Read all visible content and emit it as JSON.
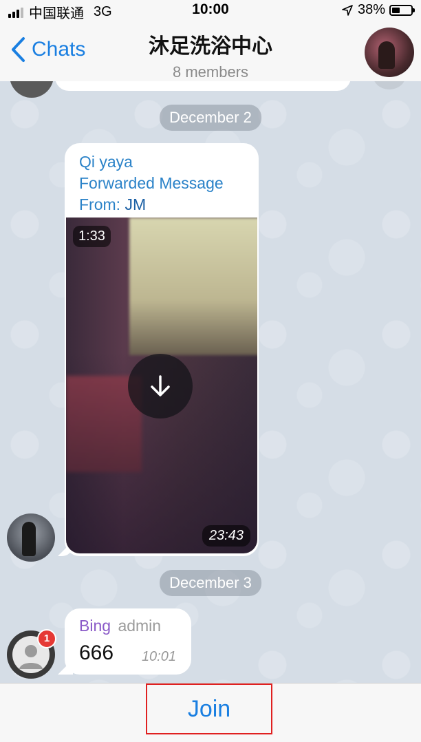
{
  "status_bar": {
    "carrier": "中国联通",
    "network": "3G",
    "time": "10:00",
    "battery": "38%",
    "battery_level": 0.38
  },
  "header": {
    "back_label": "Chats",
    "title": "沐足洗浴中心",
    "subtitle": "8 members"
  },
  "messages": [
    {
      "date": "December 2",
      "sender": "Qi yaya",
      "forward_label": "Forwarded Message",
      "from_prefix": "From:",
      "from_name": "JM",
      "video_duration": "1:33",
      "time": "23:43"
    },
    {
      "date": "December 3",
      "sender": "Bing",
      "role": "admin",
      "text": "666",
      "time": "10:01",
      "badge": "1"
    }
  ],
  "footer": {
    "join_label": "Join"
  },
  "colors": {
    "accent": "#1a7fe1",
    "highlight_border": "#e02020",
    "admin_name": "#8a5ac8",
    "forward_text": "#2a82c8"
  }
}
